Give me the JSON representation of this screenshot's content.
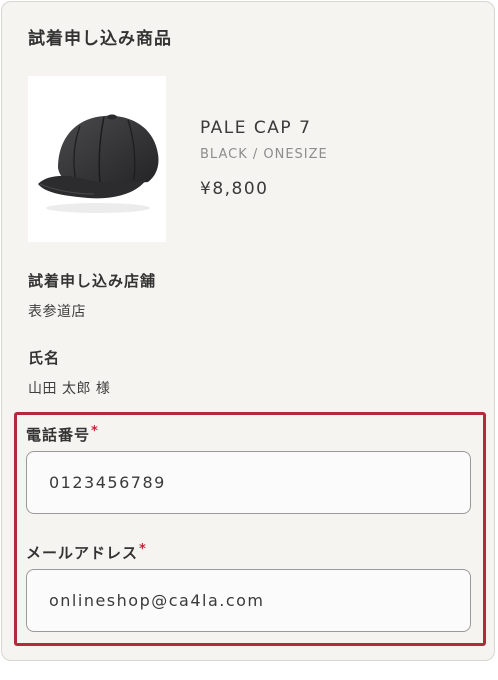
{
  "form": {
    "product_section_title": "試着申し込み商品",
    "product": {
      "name": "PALE CAP 7",
      "variant": "BLACK / ONESIZE",
      "price": "¥8,800",
      "image_icon": "black-cap-image"
    },
    "store": {
      "label": "試着申し込み店舗",
      "value": "表参道店"
    },
    "name": {
      "label": "氏名",
      "value": "山田 太郎 様"
    },
    "phone": {
      "label": "電話番号",
      "required_mark": "*",
      "value": "0123456789"
    },
    "email": {
      "label": "メールアドレス",
      "required_mark": "*",
      "value": "onlineshop@ca4la.com"
    }
  },
  "colors": {
    "card_background": "#f6f4f1",
    "highlight_border": "#b22b3b",
    "required_mark": "#c0283a"
  }
}
